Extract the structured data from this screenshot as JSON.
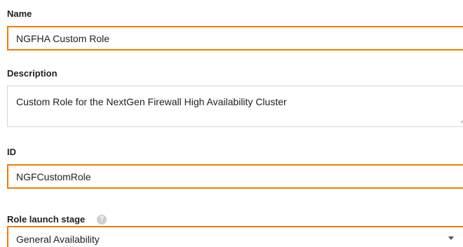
{
  "form": {
    "name": {
      "label": "Name",
      "value": "NGFHA Custom Role"
    },
    "description": {
      "label": "Description",
      "value": "Custom Role for the NextGen Firewall High Availability Cluster"
    },
    "id": {
      "label": "ID",
      "value": "NGFCustomRole"
    },
    "launch_stage": {
      "label": "Role launch stage",
      "value": "General Availability",
      "help_icon": "question-icon"
    }
  },
  "colors": {
    "highlight_border": "#f57c00",
    "plain_border": "#d6d6d6",
    "help_icon": "#cfcfcf"
  }
}
